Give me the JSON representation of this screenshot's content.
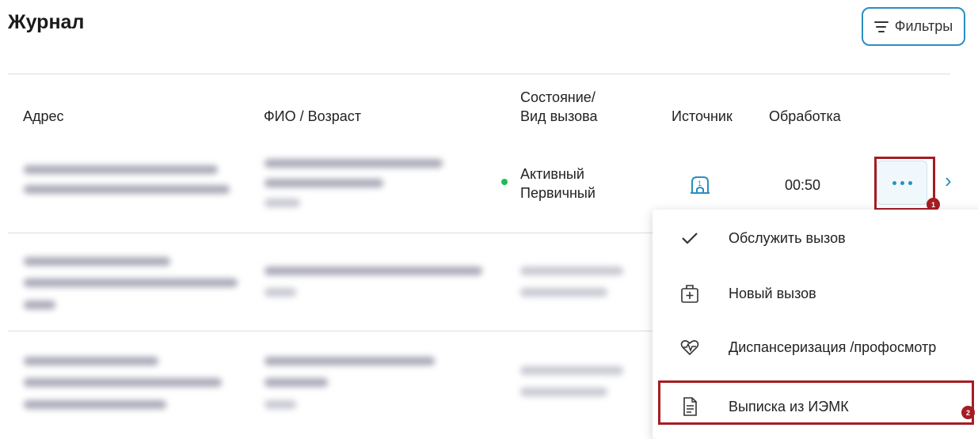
{
  "header": {
    "title": "Журнал",
    "filters_label": "Фильтры"
  },
  "table": {
    "columns": {
      "address": "Адрес",
      "fio_age": "ФИО / Возраст",
      "state_line1": "Состояние/",
      "state_line2": "Вид вызова",
      "source": "Источник",
      "processing": "Обработка"
    },
    "row1": {
      "status_line1": "Активный",
      "status_line2": "Первичный",
      "processing_time": "00:50"
    }
  },
  "context_menu": {
    "items": [
      {
        "label": "Обслужить вызов",
        "icon": "check-icon"
      },
      {
        "label": "Новый вызов",
        "icon": "medical-bag-plus-icon"
      },
      {
        "label": "Диспансеризация /профосмотр",
        "icon": "heart-pulse-icon"
      },
      {
        "label": "Выписка из ИЭМК",
        "icon": "document-icon"
      }
    ]
  },
  "annotations": {
    "badge1": "1",
    "badge2": "2",
    "accent_color": "#a51d24"
  },
  "colors": {
    "primary": "#2a8fc0",
    "status_active": "#22bb55"
  }
}
